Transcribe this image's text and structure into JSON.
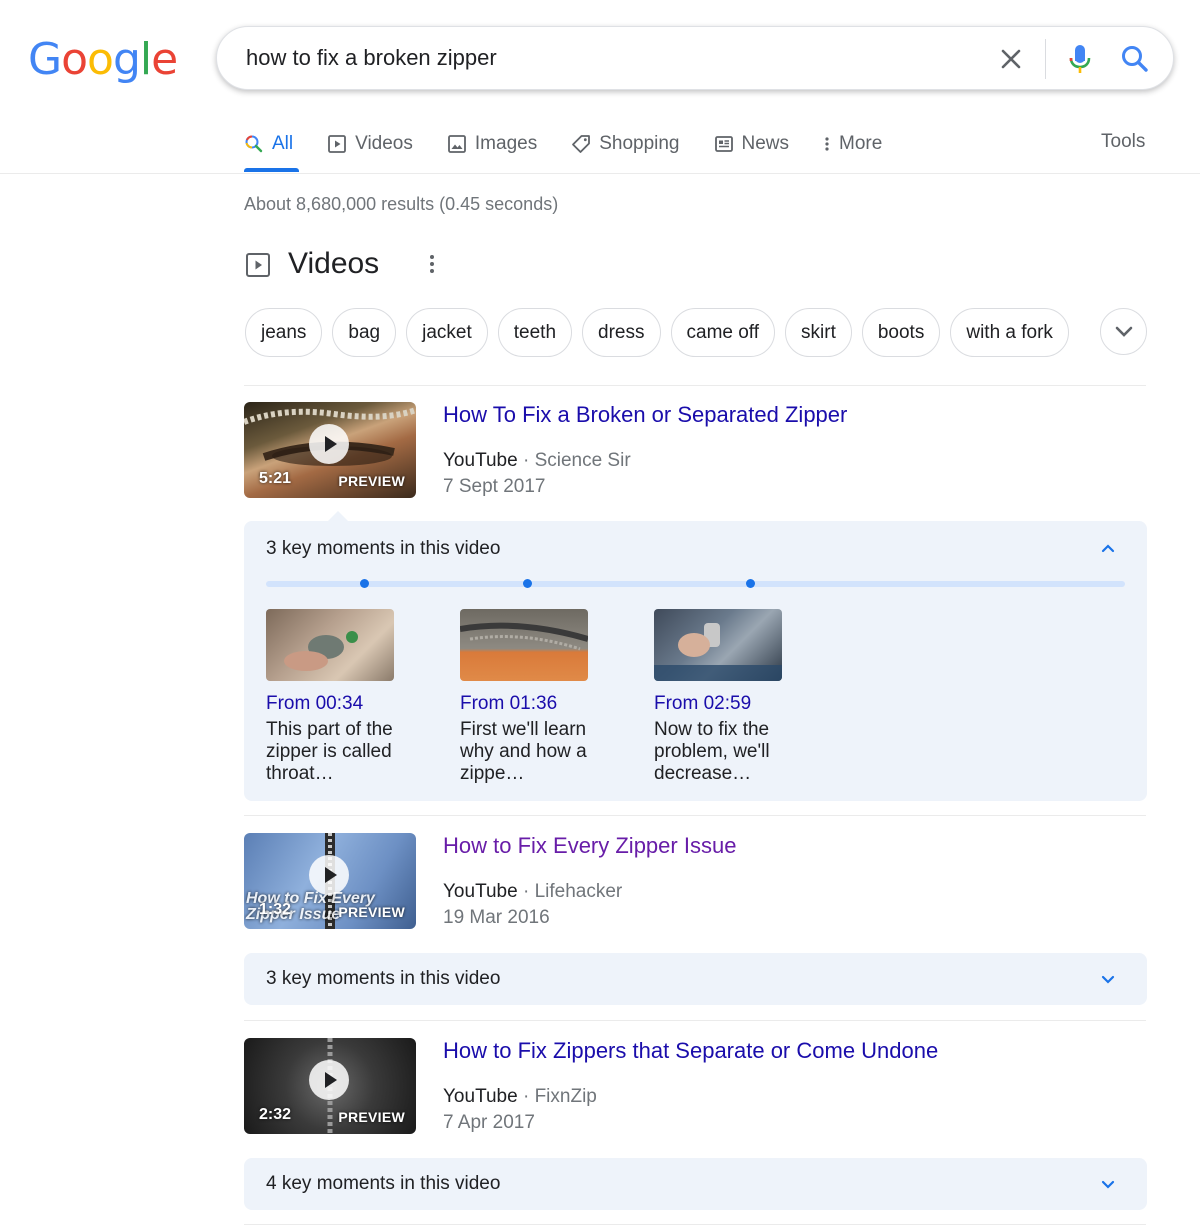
{
  "logo": {
    "letters": [
      "G",
      "o",
      "o",
      "g",
      "l",
      "e"
    ],
    "colors": [
      "#4285F4",
      "#EA4335",
      "#FBBC05",
      "#4285F4",
      "#34A853",
      "#EA4335"
    ]
  },
  "search": {
    "query": "how to fix a broken zipper"
  },
  "tabs": [
    {
      "label": "All",
      "icon": "search-icon",
      "active": true
    },
    {
      "label": "Videos",
      "icon": "video-icon"
    },
    {
      "label": "Images",
      "icon": "image-icon"
    },
    {
      "label": "Shopping",
      "icon": "tag-icon"
    },
    {
      "label": "News",
      "icon": "newspaper-icon"
    },
    {
      "label": "More",
      "icon": "more-vert-icon"
    }
  ],
  "tools_label": "Tools",
  "result_stats": "About 8,680,000 results (0.45 seconds)",
  "videos_section": {
    "heading": "Videos",
    "chips": [
      "jeans",
      "bag",
      "jacket",
      "teeth",
      "dress",
      "came off",
      "skirt",
      "boots",
      "with a fork"
    ],
    "results": [
      {
        "title": "How To Fix a Broken or Separated Zipper",
        "source": "YouTube",
        "channel": "Science Sir",
        "date": "7 Sept 2017",
        "duration": "5:21",
        "preview": "PREVIEW",
        "key_moments_label": "3 key moments in this video",
        "expanded": true,
        "moments": [
          {
            "from": "From 00:34",
            "desc": "This part of the zipper is called throat…"
          },
          {
            "from": "From 01:36",
            "desc": "First we'll learn why and how a zippe…"
          },
          {
            "from": "From 02:59",
            "desc": "Now to fix the problem, we'll decrease…"
          }
        ]
      },
      {
        "title": "How to Fix Every Zipper Issue",
        "source": "YouTube",
        "channel": "Lifehacker",
        "date": "19 Mar 2016",
        "duration": "1:32",
        "preview": "PREVIEW",
        "thumb_overlay": "How to Fix Every Zipper Issue",
        "key_moments_label": "3 key moments in this video",
        "expanded": false
      },
      {
        "title": "How to Fix Zippers that Separate or Come Undone",
        "source": "YouTube",
        "channel": "FixnZip",
        "date": "7 Apr 2017",
        "duration": "2:32",
        "preview": "PREVIEW",
        "key_moments_label": "4 key moments in this video",
        "expanded": false
      }
    ]
  },
  "separator": "·"
}
